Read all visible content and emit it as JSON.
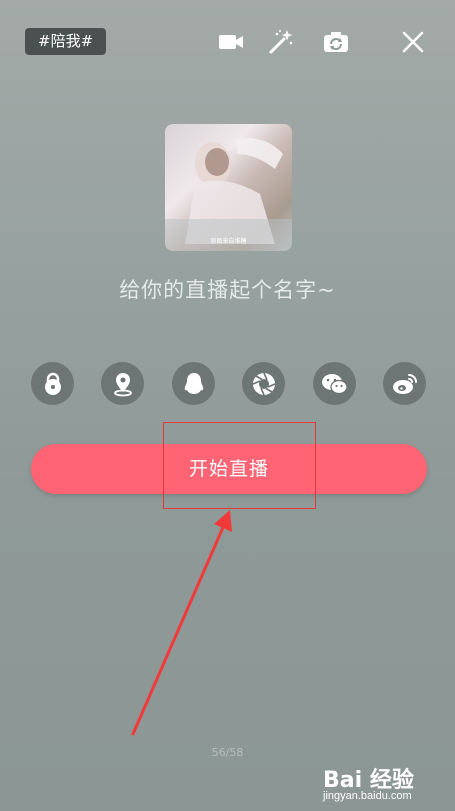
{
  "topic_tag": "#陪我#",
  "top_icons": [
    "video-camera-icon",
    "magic-wand-icon",
    "flip-camera-icon",
    "close-icon"
  ],
  "cover": {
    "caption": "原图来自堆糖"
  },
  "title_placeholder": "给你的直播起个名字~",
  "share_buttons": [
    {
      "name": "lock-icon"
    },
    {
      "name": "location-icon"
    },
    {
      "name": "qq-icon"
    },
    {
      "name": "qzone-aperture-icon"
    },
    {
      "name": "wechat-icon"
    },
    {
      "name": "weibo-icon"
    }
  ],
  "start_button": {
    "label": "开始直播",
    "color": "#ff6474"
  },
  "counter": "56/58",
  "watermark": {
    "brand": "Bai 经验",
    "url": "jingyan.baidu.com"
  },
  "annotation": {
    "box_color": "#e63a3a",
    "arrow_color": "#f03a3a"
  }
}
